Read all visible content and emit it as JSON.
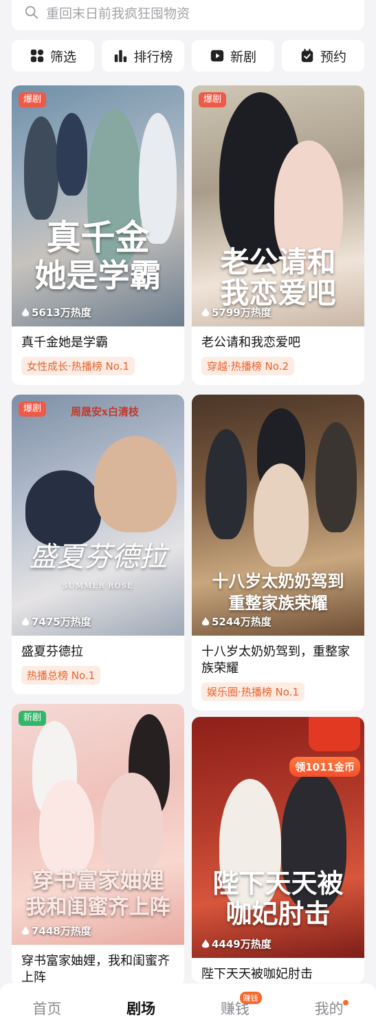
{
  "search": {
    "placeholder": "重回末日前我疯狂囤物资",
    "icon": "search-icon"
  },
  "categories": [
    {
      "label": "筛选",
      "icon": "filter-grid-icon"
    },
    {
      "label": "排行榜",
      "icon": "bar-chart-icon"
    },
    {
      "label": "新剧",
      "icon": "play-square-icon"
    },
    {
      "label": "预约",
      "icon": "calendar-check-icon"
    }
  ],
  "colors": {
    "accent": "#f56a2e",
    "tag_bg": "#fdece3",
    "hot_badge": "#ee5a48",
    "new_badge": "#33b56a"
  },
  "dramas": [
    {
      "name": "真千金她是学霸",
      "badge": "爆剧",
      "heat": "5613万热度",
      "tag": "女性成长·热播榜 No.1",
      "poster_title_1": "真千金",
      "poster_title_2": "她是学霸"
    },
    {
      "name": "老公请和我恋爱吧",
      "badge": "爆剧",
      "heat": "5799万热度",
      "tag": "穿越·热播榜 No.2",
      "poster_title_1": "老公请和",
      "poster_title_2": "我恋爱吧"
    },
    {
      "name": "盛夏芬德拉",
      "badge": "爆剧",
      "heat": "7475万热度",
      "tag": "热播总榜 No.1",
      "poster_title_1": "盛夏芬德拉",
      "poster_subtitle": "SUMMER ROSE",
      "poster_cast": "周晟安x白清枝"
    },
    {
      "name": "十八岁太奶奶驾到，重整家族荣耀",
      "badge": "",
      "heat": "5244万热度",
      "tag": "娱乐圈·热播榜 No.1",
      "poster_title_1": "十八岁太奶奶驾到",
      "poster_title_2": "重整家族荣耀"
    },
    {
      "name": "穿书富家妯娌，我和闺蜜齐上阵",
      "badge": "新剧",
      "heat": "7448万热度",
      "tag": "",
      "poster_title_1": "穿书富家妯娌",
      "poster_title_2": "我和闺蜜齐上阵"
    },
    {
      "name": "陛下天天被咖妃肘击",
      "badge": "",
      "heat": "4449万热度",
      "tag": "",
      "poster_title_1": "陛下天天被",
      "poster_title_2": "咖妃肘击",
      "coin_label": "领1011金币"
    }
  ],
  "tabbar": [
    {
      "label": "首页",
      "active": false
    },
    {
      "label": "剧场",
      "active": true
    },
    {
      "label": "赚钱",
      "active": false,
      "pill": "赚钱"
    },
    {
      "label": "我的",
      "active": false
    }
  ]
}
